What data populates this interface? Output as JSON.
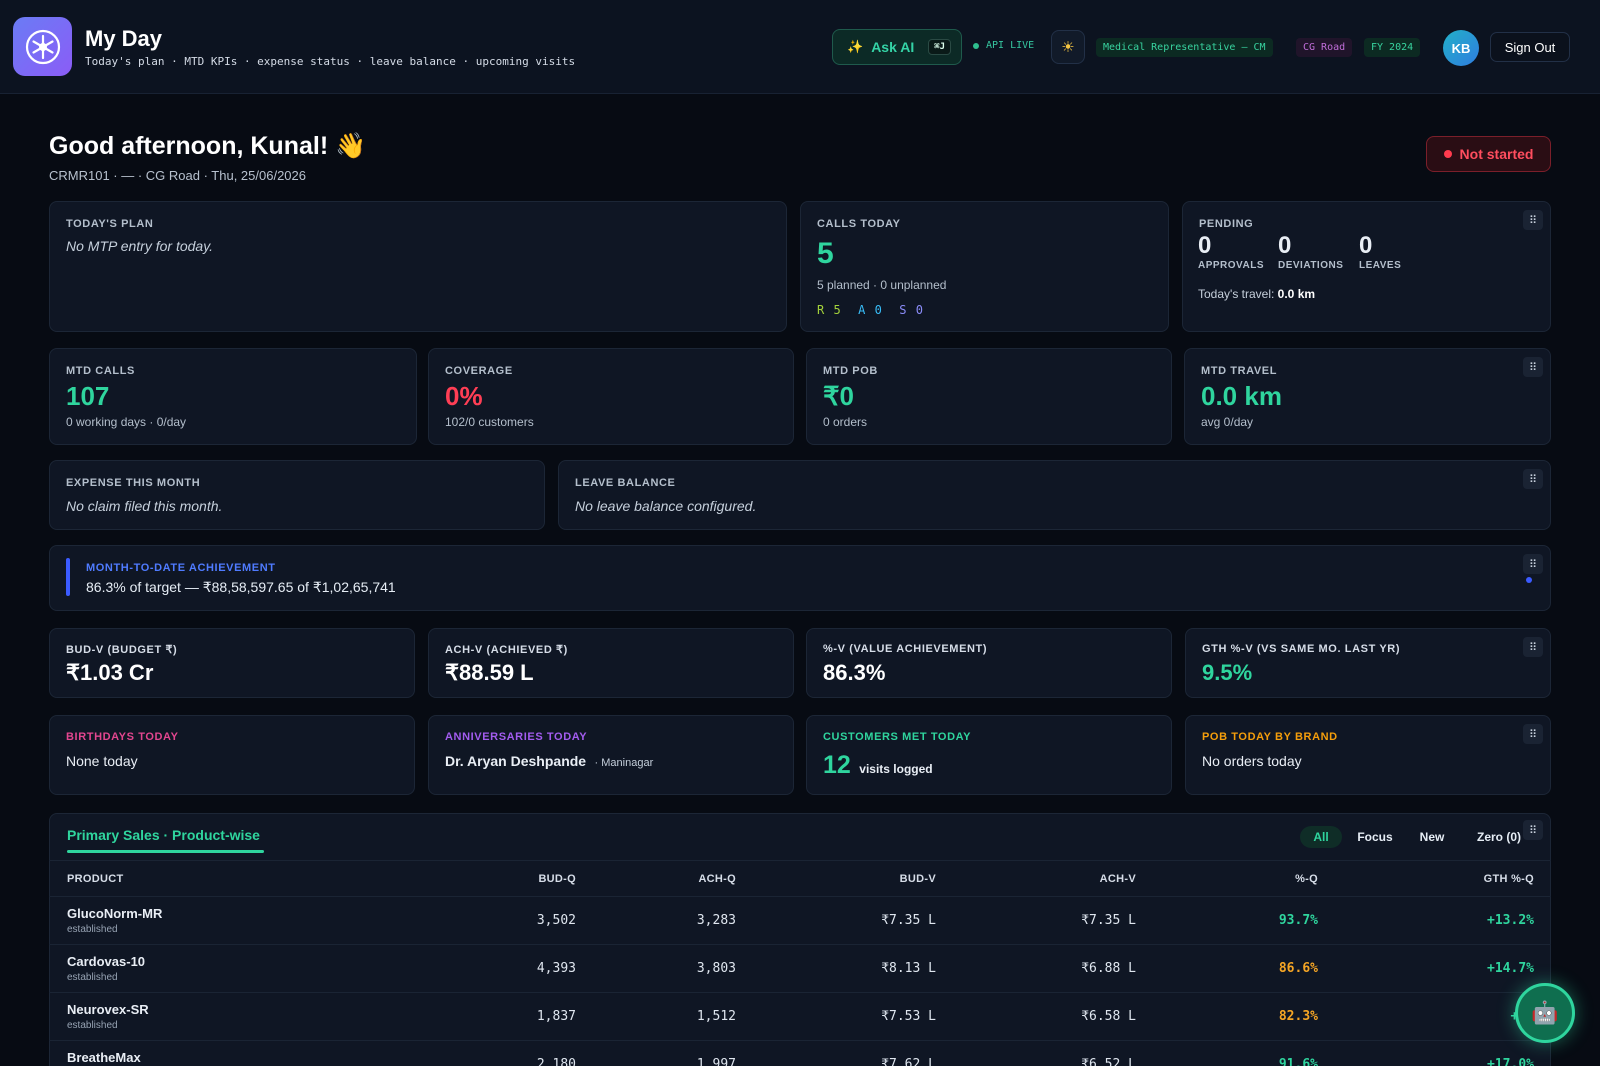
{
  "header": {
    "title": "My Day",
    "subtitle": "Today's plan · MTD KPIs · expense status · leave balance · upcoming visits",
    "ask_ai": "Ask AI",
    "ask_ai_kbd": "⌘J",
    "api_status": "API LIVE",
    "role": "Medical Representative — CM",
    "location": "CG Road",
    "fy": "FY 2024",
    "avatar_initials": "KB",
    "sign_out": "Sign Out"
  },
  "greeting": {
    "text": "Good afternoon, Kunal! 👋",
    "meta": "CRMR101 · — · CG Road · Thu, 25/06/2026",
    "status": "Not started"
  },
  "today_plan": {
    "label": "TODAY'S PLAN",
    "text": "No MTP entry for today."
  },
  "calls_today": {
    "label": "CALLS TODAY",
    "value": "5",
    "sub": "5 planned · 0 unplanned",
    "r": "R 5",
    "a": "A 0",
    "s": "S 0"
  },
  "pending": {
    "label": "PENDING",
    "approvals": "0",
    "approvals_label": "APPROVALS",
    "deviations": "0",
    "deviations_label": "DEVIATIONS",
    "leaves": "0",
    "leaves_label": "LEAVES",
    "travel_label": "Today's travel:",
    "travel_value": "0.0 km"
  },
  "mtd_calls": {
    "label": "MTD CALLS",
    "value": "107",
    "sub": "0 working days · 0/day"
  },
  "coverage": {
    "label": "COVERAGE",
    "value": "0%",
    "sub": "102/0 customers"
  },
  "mtd_pob": {
    "label": "MTD POB",
    "value": "₹0",
    "sub": "0 orders"
  },
  "mtd_travel": {
    "label": "MTD TRAVEL",
    "value": "0.0 km",
    "sub": "avg 0/day"
  },
  "expense": {
    "label": "EXPENSE THIS MONTH",
    "text": "No claim filed this month."
  },
  "leave": {
    "label": "LEAVE BALANCE",
    "text": "No leave balance configured."
  },
  "achievement": {
    "label": "MONTH-TO-DATE ACHIEVEMENT",
    "text": "86.3% of target — ₹88,58,597.65 of ₹1,02,65,741",
    "percent": 86.3
  },
  "kpis": {
    "bud_v": {
      "label": "BUD-V (BUDGET ₹)",
      "value": "₹1.03 Cr"
    },
    "ach_v": {
      "label": "ACH-V (ACHIEVED ₹)",
      "value": "₹88.59 L"
    },
    "pct_v": {
      "label": "%-V (VALUE ACHIEVEMENT)",
      "value": "86.3%"
    },
    "gth_v": {
      "label": "GTH %-V (VS SAME MO. LAST YR)",
      "value": "9.5%"
    }
  },
  "birthdays": {
    "label": "BIRTHDAYS TODAY",
    "text": "None today"
  },
  "anniversaries": {
    "label": "ANNIVERSARIES TODAY",
    "name": "Dr. Aryan Deshpande",
    "place": "· Maninagar"
  },
  "customers_met": {
    "label": "CUSTOMERS MET TODAY",
    "value": "12",
    "sub": "visits logged"
  },
  "pob_brand": {
    "label": "POB TODAY BY BRAND",
    "text": "No orders today"
  },
  "sales": {
    "tab": "Primary Sales · Product-wise",
    "filters": [
      "All",
      "Focus",
      "New",
      "Zero (0)"
    ],
    "columns": [
      "PRODUCT",
      "BUD-Q",
      "ACH-Q",
      "BUD-V",
      "ACH-V",
      "%-Q",
      "GTH %-Q"
    ],
    "rows": [
      {
        "name": "GlucoNorm-MR",
        "tag": "established",
        "bud_q": "3,502",
        "ach_q": "3,283",
        "bud_v": "₹7.35 L",
        "ach_v": "₹7.35 L",
        "pct_q": "93.7%",
        "gth": "+13.2%"
      },
      {
        "name": "Cardovas-10",
        "tag": "established",
        "bud_q": "4,393",
        "ach_q": "3,803",
        "bud_v": "₹8.13 L",
        "ach_v": "₹6.88 L",
        "pct_q": "86.6%",
        "gth": "+14.7%"
      },
      {
        "name": "Neurovex-SR",
        "tag": "established",
        "bud_q": "1,837",
        "ach_q": "1,512",
        "bud_v": "₹7.53 L",
        "ach_v": "₹6.58 L",
        "pct_q": "82.3%",
        "gth": "+4."
      },
      {
        "name": "BreatheMax",
        "tag": "",
        "bud_q": "2,180",
        "ach_q": "1,997",
        "bud_v": "₹7.62 L",
        "ach_v": "₹6.52 L",
        "pct_q": "91.6%",
        "gth": "+17.0%"
      }
    ]
  },
  "colors": {
    "accent": "#2fd59e",
    "danger": "#ff3e55",
    "warning": "#f5a524",
    "indigo": "#3b5bff"
  },
  "icons": {
    "logo": "snowflake-logo-icon",
    "ai": "sparkle-icon",
    "theme": "sun-icon",
    "drag": "drag-handle-icon",
    "fab": "robot-icon"
  }
}
